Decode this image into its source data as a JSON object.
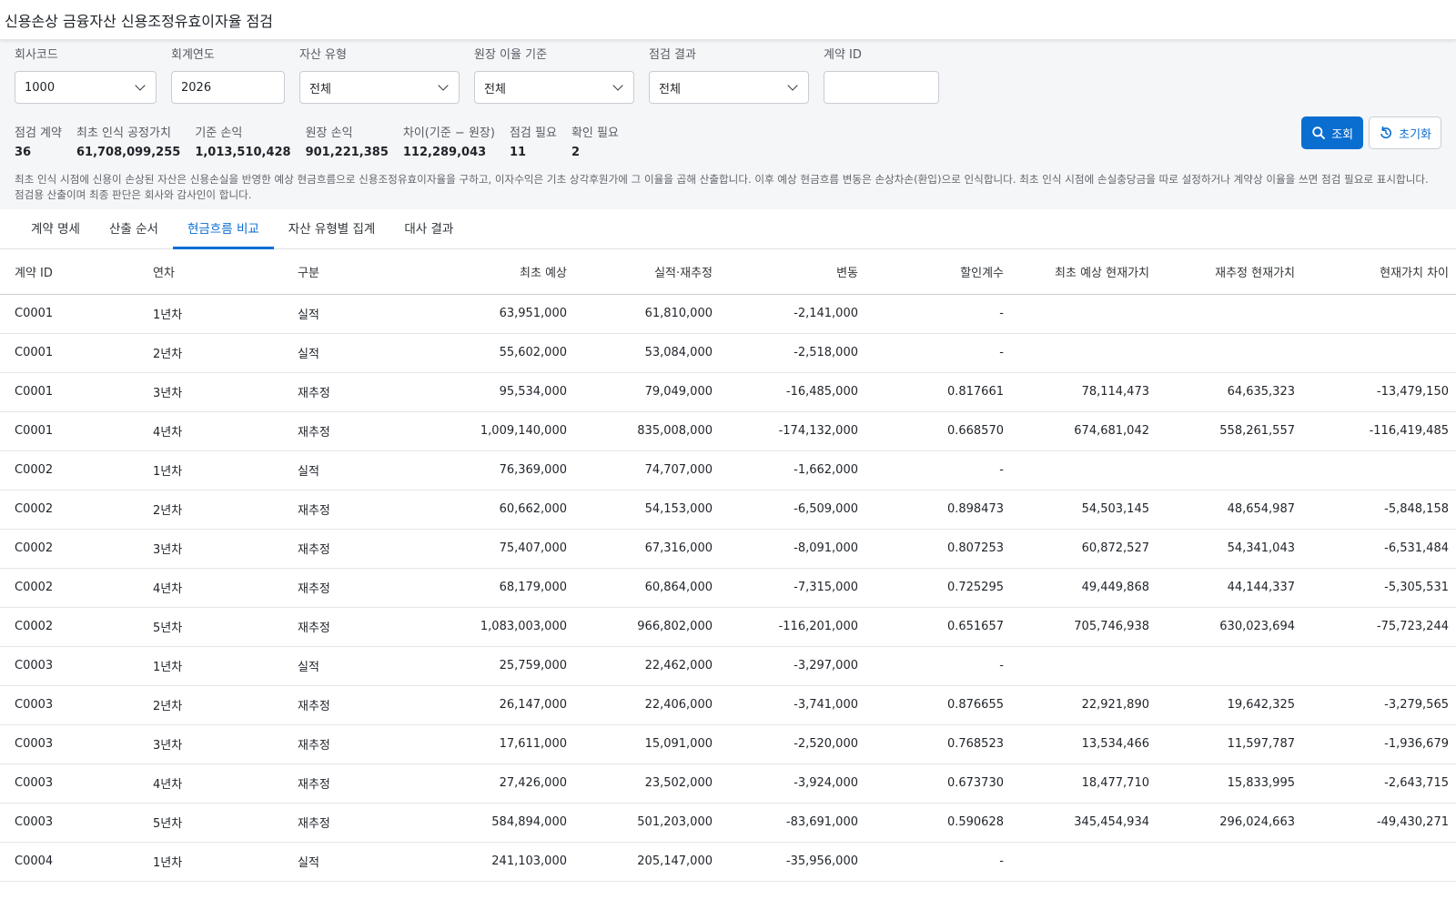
{
  "app": {
    "title": "신용손상 금융자산 신용조정유효이자율 점검"
  },
  "filters": [
    {
      "key": "company",
      "label": "회사코드",
      "value": "1000",
      "type": "select"
    },
    {
      "key": "year",
      "label": "회계연도",
      "value": "2026",
      "type": "input"
    },
    {
      "key": "asset_type",
      "label": "자산 유형",
      "value": "전체",
      "type": "select"
    },
    {
      "key": "rate_basis",
      "label": "원장 이율 기준",
      "value": "전체",
      "type": "select"
    },
    {
      "key": "result",
      "label": "점검 결과",
      "value": "전체",
      "type": "select"
    },
    {
      "key": "contract_id",
      "label": "계약 ID",
      "value": "",
      "type": "input"
    }
  ],
  "actions": {
    "search_label": "조회",
    "reset_label": "초기화"
  },
  "summary": [
    {
      "label": "점검 계약",
      "value": "36"
    },
    {
      "label": "최초 인식 공정가치",
      "value": "61,708,099,255"
    },
    {
      "label": "기준 손익",
      "value": "1,013,510,428"
    },
    {
      "label": "원장 손익",
      "value": "901,221,385"
    },
    {
      "label": "차이(기준 − 원장)",
      "value": "112,289,043"
    },
    {
      "label": "점검 필요",
      "value": "11"
    },
    {
      "label": "확인 필요",
      "value": "2"
    }
  ],
  "note": "최초 인식 시점에 신용이 손상된 자산은 신용손실을 반영한 예상 현금흐름으로 신용조정유효이자율을 구하고, 이자수익은 기초 상각후원가에 그 이율을 곱해 산출합니다. 이후 예상 현금흐름 변동은 손상차손(환입)으로 인식합니다. 최초 인식 시점에 손실충당금을 따로 설정하거나 계약상 이율을 쓰면 점검 필요로 표시합니다. 점검용 산출이며 최종 판단은 회사와 감사인이 합니다.",
  "tabs": [
    {
      "label": "계약 명세",
      "active": false
    },
    {
      "label": "산출 순서",
      "active": false
    },
    {
      "label": "현금흐름 비교",
      "active": true
    },
    {
      "label": "자산 유형별 집계",
      "active": false
    },
    {
      "label": "대사 결과",
      "active": false
    }
  ],
  "table": {
    "columns": [
      "계약 ID",
      "연차",
      "구분",
      "최초 예상",
      "실적·재추정",
      "변동",
      "할인계수",
      "최초 예상 현재가치",
      "재추정 현재가치",
      "현재가치 차이"
    ],
    "rows": [
      [
        "C0001",
        "1년차",
        "실적",
        "63,951,000",
        "61,810,000",
        "-2,141,000",
        "-",
        "",
        "",
        ""
      ],
      [
        "C0001",
        "2년차",
        "실적",
        "55,602,000",
        "53,084,000",
        "-2,518,000",
        "-",
        "",
        "",
        ""
      ],
      [
        "C0001",
        "3년차",
        "재추정",
        "95,534,000",
        "79,049,000",
        "-16,485,000",
        "0.817661",
        "78,114,473",
        "64,635,323",
        "-13,479,150"
      ],
      [
        "C0001",
        "4년차",
        "재추정",
        "1,009,140,000",
        "835,008,000",
        "-174,132,000",
        "0.668570",
        "674,681,042",
        "558,261,557",
        "-116,419,485"
      ],
      [
        "C0002",
        "1년차",
        "실적",
        "76,369,000",
        "74,707,000",
        "-1,662,000",
        "-",
        "",
        "",
        ""
      ],
      [
        "C0002",
        "2년차",
        "재추정",
        "60,662,000",
        "54,153,000",
        "-6,509,000",
        "0.898473",
        "54,503,145",
        "48,654,987",
        "-5,848,158"
      ],
      [
        "C0002",
        "3년차",
        "재추정",
        "75,407,000",
        "67,316,000",
        "-8,091,000",
        "0.807253",
        "60,872,527",
        "54,341,043",
        "-6,531,484"
      ],
      [
        "C0002",
        "4년차",
        "재추정",
        "68,179,000",
        "60,864,000",
        "-7,315,000",
        "0.725295",
        "49,449,868",
        "44,144,337",
        "-5,305,531"
      ],
      [
        "C0002",
        "5년차",
        "재추정",
        "1,083,003,000",
        "966,802,000",
        "-116,201,000",
        "0.651657",
        "705,746,938",
        "630,023,694",
        "-75,723,244"
      ],
      [
        "C0003",
        "1년차",
        "실적",
        "25,759,000",
        "22,462,000",
        "-3,297,000",
        "-",
        "",
        "",
        ""
      ],
      [
        "C0003",
        "2년차",
        "재추정",
        "26,147,000",
        "22,406,000",
        "-3,741,000",
        "0.876655",
        "22,921,890",
        "19,642,325",
        "-3,279,565"
      ],
      [
        "C0003",
        "3년차",
        "재추정",
        "17,611,000",
        "15,091,000",
        "-2,520,000",
        "0.768523",
        "13,534,466",
        "11,597,787",
        "-1,936,679"
      ],
      [
        "C0003",
        "4년차",
        "재추정",
        "27,426,000",
        "23,502,000",
        "-3,924,000",
        "0.673730",
        "18,477,710",
        "15,833,995",
        "-2,643,715"
      ],
      [
        "C0003",
        "5년차",
        "재추정",
        "584,894,000",
        "501,203,000",
        "-83,691,000",
        "0.590628",
        "345,454,934",
        "296,024,663",
        "-49,430,271"
      ],
      [
        "C0004",
        "1년차",
        "실적",
        "241,103,000",
        "205,147,000",
        "-35,956,000",
        "-",
        "",
        "",
        ""
      ]
    ]
  }
}
